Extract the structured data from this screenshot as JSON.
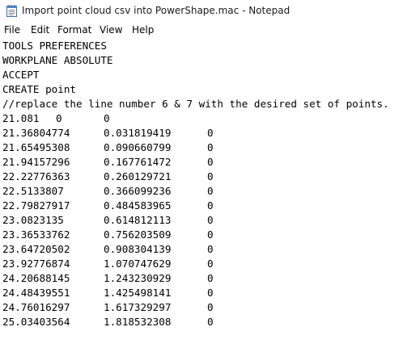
{
  "window": {
    "title": "Import point cloud csv into PowerShape.mac - Notepad",
    "icon": "notepad-icon"
  },
  "menu": {
    "items": [
      "File",
      "Edit",
      "Format",
      "View",
      "Help"
    ]
  },
  "editor": {
    "header_lines": [
      "TOOLS PREFERENCES",
      "WORKPLANE ABSOLUTE",
      "ACCEPT",
      "CREATE point",
      "//replace the line number 6 & 7 with the desired set of points."
    ],
    "rows": [
      [
        "21.081",
        "0",
        "0"
      ],
      [
        "21.36804774",
        "0.031819419",
        "0"
      ],
      [
        "21.65495308",
        "0.090660799",
        "0"
      ],
      [
        "21.94157296",
        "0.167761472",
        "0"
      ],
      [
        "22.22776363",
        "0.260129721",
        "0"
      ],
      [
        "22.5133807",
        "0.366099236",
        "0"
      ],
      [
        "22.79827917",
        "0.484583965",
        "0"
      ],
      [
        "23.0823135",
        "0.614812113",
        "0"
      ],
      [
        "23.36533762",
        "0.756203509",
        "0"
      ],
      [
        "23.64720502",
        "0.908304139",
        "0"
      ],
      [
        "23.92776874",
        "1.070747629",
        "0"
      ],
      [
        "24.20688145",
        "1.243230929",
        "0"
      ],
      [
        "24.48439551",
        "1.425498141",
        "0"
      ],
      [
        "24.76016297",
        "1.617329297",
        "0"
      ],
      [
        "25.03403564",
        "1.818532308",
        "0"
      ]
    ]
  }
}
